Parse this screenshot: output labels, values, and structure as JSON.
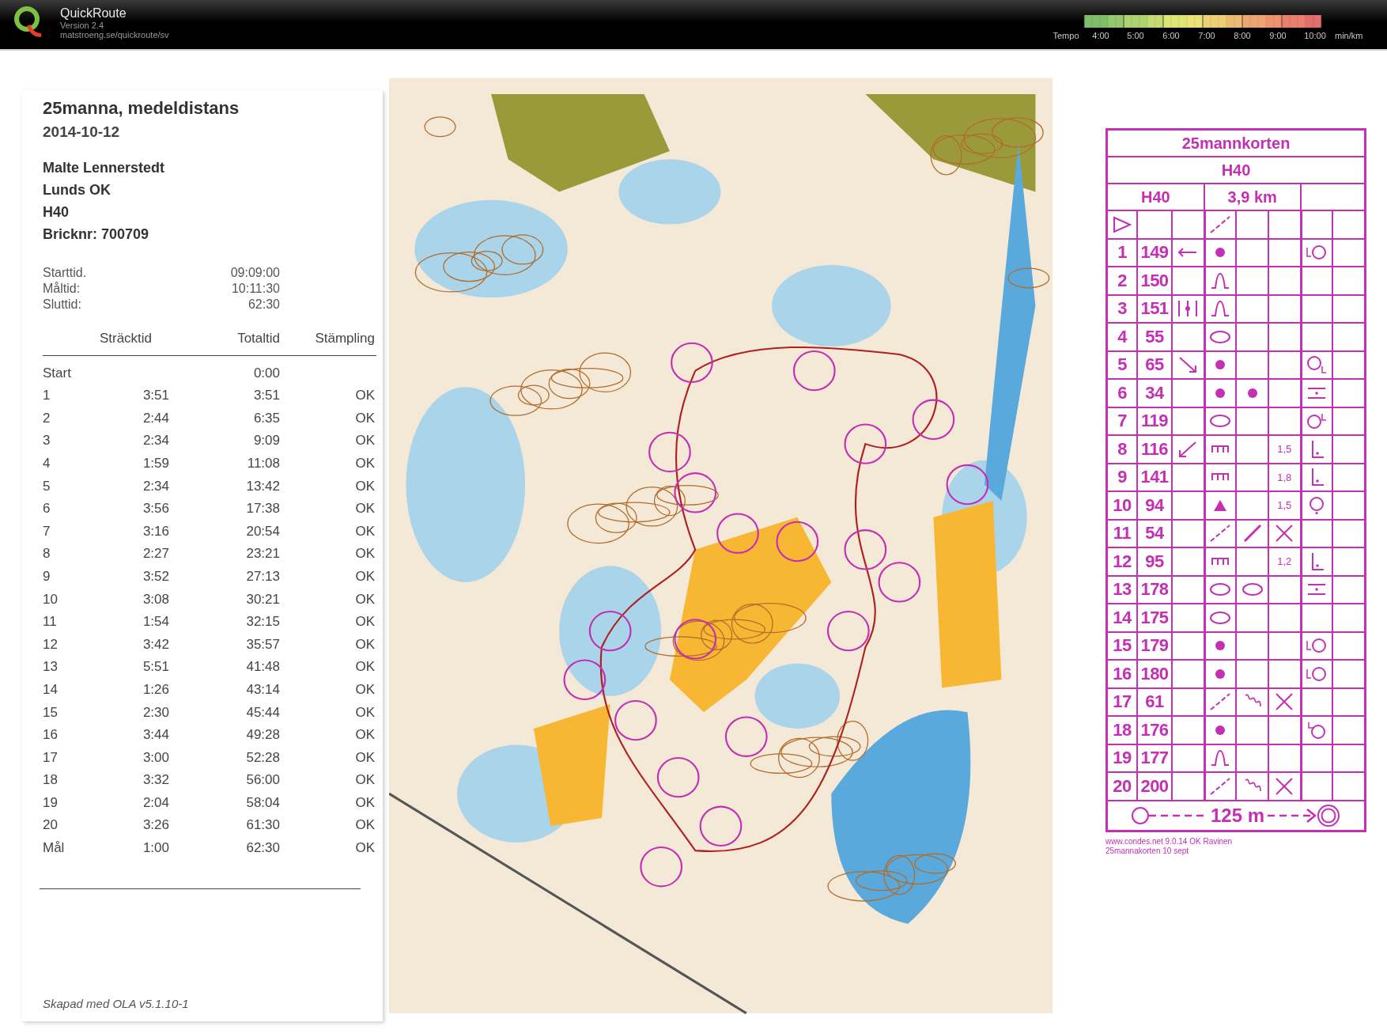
{
  "app": {
    "title": "QuickRoute",
    "version": "Version 2.4",
    "url": "matstroeng.se/quickroute/sv"
  },
  "tempo": {
    "label": "Tempo",
    "ticks": [
      "4:00",
      "5:00",
      "6:00",
      "7:00",
      "8:00",
      "9:00",
      "10:00"
    ],
    "unit": "min/km"
  },
  "splits_sheet": {
    "title": "25manna, medeldistans",
    "date": "2014-10-12",
    "runner": [
      "Malte Lennerstedt",
      "Lunds OK",
      "H40",
      "Bricknr: 700709"
    ],
    "times": [
      {
        "label": "Starttid.",
        "value": "09:09:00"
      },
      {
        "label": "Måltid:",
        "value": "10:11:30"
      },
      {
        "label": "Sluttid:",
        "value": "62:30"
      }
    ],
    "columns": [
      "Sträcktid",
      "Totaltid",
      "Stämpling"
    ],
    "rows": [
      {
        "control": "Start",
        "total": "0:00"
      },
      {
        "control": "1",
        "split": "3:51",
        "total": "3:51",
        "status": "OK"
      },
      {
        "control": "2",
        "split": "2:44",
        "total": "6:35",
        "status": "OK"
      },
      {
        "control": "3",
        "split": "2:34",
        "total": "9:09",
        "status": "OK"
      },
      {
        "control": "4",
        "split": "1:59",
        "total": "11:08",
        "status": "OK"
      },
      {
        "control": "5",
        "split": "2:34",
        "total": "13:42",
        "status": "OK"
      },
      {
        "control": "6",
        "split": "3:56",
        "total": "17:38",
        "status": "OK"
      },
      {
        "control": "7",
        "split": "3:16",
        "total": "20:54",
        "status": "OK"
      },
      {
        "control": "8",
        "split": "2:27",
        "total": "23:21",
        "status": "OK"
      },
      {
        "control": "9",
        "split": "3:52",
        "total": "27:13",
        "status": "OK"
      },
      {
        "control": "10",
        "split": "3:08",
        "total": "30:21",
        "status": "OK"
      },
      {
        "control": "11",
        "split": "1:54",
        "total": "32:15",
        "status": "OK"
      },
      {
        "control": "12",
        "split": "3:42",
        "total": "35:57",
        "status": "OK"
      },
      {
        "control": "13",
        "split": "5:51",
        "total": "41:48",
        "status": "OK"
      },
      {
        "control": "14",
        "split": "1:26",
        "total": "43:14",
        "status": "OK"
      },
      {
        "control": "15",
        "split": "2:30",
        "total": "45:44",
        "status": "OK"
      },
      {
        "control": "16",
        "split": "3:44",
        "total": "49:28",
        "status": "OK"
      },
      {
        "control": "17",
        "split": "3:00",
        "total": "52:28",
        "status": "OK"
      },
      {
        "control": "18",
        "split": "3:32",
        "total": "56:00",
        "status": "OK"
      },
      {
        "control": "19",
        "split": "2:04",
        "total": "58:04",
        "status": "OK"
      },
      {
        "control": "20",
        "split": "3:26",
        "total": "61:30",
        "status": "OK"
      },
      {
        "control": "Mål",
        "split": "1:00",
        "total": "62:30",
        "status": "OK"
      }
    ],
    "footer": "Skapad med OLA v5.1.10-1"
  },
  "control_card": {
    "title": "25mannkorten",
    "class": "H40",
    "course": "H40",
    "length": "3,9 km",
    "start": {
      "d": {
        "kind": "path"
      }
    },
    "rows": [
      {
        "num": "1",
        "code": "149",
        "c": {
          "kind": "arrow_w"
        },
        "d": {
          "kind": "dot"
        },
        "g": {
          "kind": "l_circle"
        }
      },
      {
        "num": "2",
        "code": "150",
        "d": {
          "kind": "knoll"
        }
      },
      {
        "num": "3",
        "code": "151",
        "c": {
          "kind": "between"
        },
        "d": {
          "kind": "knoll"
        }
      },
      {
        "num": "4",
        "code": "55",
        "d": {
          "kind": "ellipse"
        }
      },
      {
        "num": "5",
        "code": "65",
        "c": {
          "kind": "arrow_se"
        },
        "d": {
          "kind": "dot"
        },
        "g": {
          "kind": "circle_l_low"
        }
      },
      {
        "num": "6",
        "code": "34",
        "d": {
          "kind": "dot"
        },
        "e": {
          "kind": "dot"
        },
        "g": {
          "kind": "between_lines"
        }
      },
      {
        "num": "7",
        "code": "119",
        "d": {
          "kind": "ellipse"
        },
        "g": {
          "kind": "circle_l_high"
        }
      },
      {
        "num": "8",
        "code": "116",
        "c": {
          "kind": "arrow_sw"
        },
        "d": {
          "kind": "comb"
        },
        "f": {
          "kind": "text",
          "text": "1,5"
        },
        "g": {
          "kind": "foot"
        }
      },
      {
        "num": "9",
        "code": "141",
        "d": {
          "kind": "comb"
        },
        "f": {
          "kind": "text",
          "text": "1,8"
        },
        "g": {
          "kind": "foot"
        }
      },
      {
        "num": "10",
        "code": "94",
        "d": {
          "kind": "triangle"
        },
        "f": {
          "kind": "text",
          "text": "1,5"
        },
        "g": {
          "kind": "circle_dot_below"
        }
      },
      {
        "num": "11",
        "code": "54",
        "d": {
          "kind": "path"
        },
        "e": {
          "kind": "slash"
        },
        "f": {
          "kind": "cross"
        }
      },
      {
        "num": "12",
        "code": "95",
        "d": {
          "kind": "comb"
        },
        "f": {
          "kind": "text",
          "text": "1,2"
        },
        "g": {
          "kind": "foot"
        }
      },
      {
        "num": "13",
        "code": "178",
        "d": {
          "kind": "ellipse"
        },
        "e": {
          "kind": "ellipse"
        },
        "g": {
          "kind": "between_lines"
        }
      },
      {
        "num": "14",
        "code": "175",
        "d": {
          "kind": "ellipse"
        }
      },
      {
        "num": "15",
        "code": "179",
        "d": {
          "kind": "dot"
        },
        "g": {
          "kind": "l_circle"
        }
      },
      {
        "num": "16",
        "code": "180",
        "d": {
          "kind": "dot"
        },
        "g": {
          "kind": "l_circle"
        }
      },
      {
        "num": "17",
        "code": "61",
        "d": {
          "kind": "path"
        },
        "e": {
          "kind": "wavy"
        },
        "f": {
          "kind": "cross"
        }
      },
      {
        "num": "18",
        "code": "176",
        "d": {
          "kind": "dot"
        },
        "g": {
          "kind": "hook_circle"
        }
      },
      {
        "num": "19",
        "code": "177",
        "d": {
          "kind": "knoll"
        }
      },
      {
        "num": "20",
        "code": "200",
        "d": {
          "kind": "path"
        },
        "e": {
          "kind": "wavy"
        },
        "f": {
          "kind": "cross"
        }
      }
    ],
    "finish": "125 m",
    "notes": [
      "www.condes.net 9.0.14 OK Ravinen",
      "25mannakorten 10 sept"
    ]
  }
}
